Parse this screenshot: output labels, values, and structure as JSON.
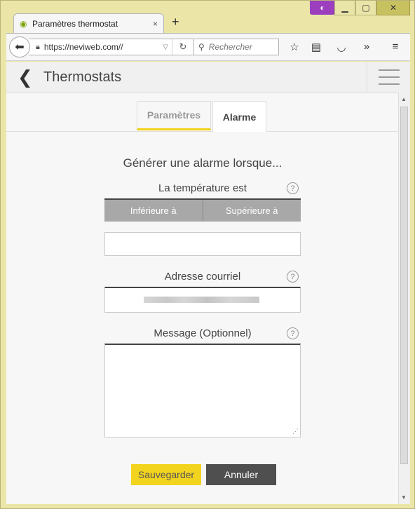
{
  "browser": {
    "tab_title": "Paramètres thermostat",
    "tab_close": "×",
    "new_tab": "+",
    "url": "https://neviweb.com//",
    "search_placeholder": "Rechercher"
  },
  "app": {
    "title": "Thermostats"
  },
  "tabs": [
    {
      "label": "Paramètres",
      "active": false
    },
    {
      "label": "Alarme",
      "active": true
    }
  ],
  "form": {
    "heading": "Générer une alarme lorsque...",
    "temperature_label": "La température est",
    "segment_options": [
      "Inférieure à",
      "Supérieure à"
    ],
    "temperature_value": "",
    "email_label": "Adresse courriel",
    "message_label": "Message (Optionnel)",
    "message_value": "",
    "help_glyph": "?"
  },
  "buttons": {
    "save": "Sauvegarder",
    "cancel": "Annuler"
  },
  "colors": {
    "accent": "#f2d41e",
    "window_frame": "#ebe6a7",
    "private_badge": "#9b3fbf"
  }
}
